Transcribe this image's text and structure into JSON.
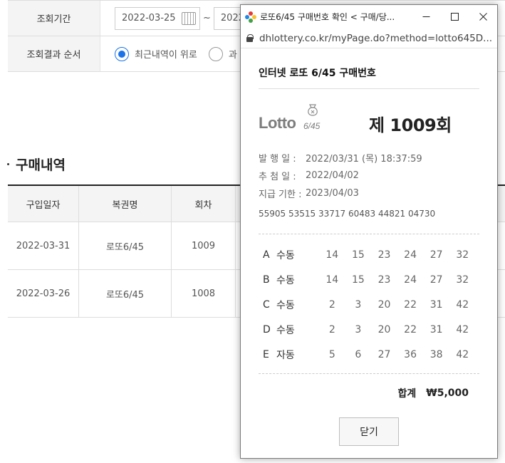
{
  "bg_page": {
    "filters": {
      "period_label": "조회기간",
      "date_start": "2022-03-25",
      "date_sep": "~",
      "date_end_partial": "2022",
      "order_label": "조회결과 순서",
      "order_option_1": "최근내역이 위로",
      "order_option_2": "과"
    },
    "section_title": "구매내역",
    "table": {
      "headers": [
        "구입일자",
        "복권명",
        "회차"
      ],
      "rows": [
        {
          "date": "2022-03-31",
          "name": "로또6/45",
          "round": "1009"
        },
        {
          "date": "2022-03-26",
          "name": "로또6/45",
          "round": "1008"
        }
      ]
    }
  },
  "popup": {
    "window_title": "로또6/45 구매번호 확인 < 구매/당...",
    "url": "dhlottery.co.kr/myPage.do?method=lotto645D...",
    "heading": "인터넷 로또 6/45 구매번호",
    "logo_word": "Lotto",
    "logo_sub": "6/45",
    "draw_title": "제 1009회",
    "info": {
      "issue_label": "발 행 일 :",
      "issue_value": "2022/03/31 (목) 18:37:59",
      "draw_label": "추 첨 일 :",
      "draw_value": "2022/04/02",
      "payout_label": "지급 기한 :",
      "payout_value": "2023/04/03",
      "serial": "55905 53515 33717 60483 44821 04730"
    },
    "games": [
      {
        "letter": "A",
        "mode": "수동",
        "numbers": [
          "14",
          "15",
          "23",
          "24",
          "27",
          "32"
        ]
      },
      {
        "letter": "B",
        "mode": "수동",
        "numbers": [
          "14",
          "15",
          "23",
          "24",
          "27",
          "32"
        ]
      },
      {
        "letter": "C",
        "mode": "수동",
        "numbers": [
          "2",
          "3",
          "20",
          "22",
          "31",
          "42"
        ]
      },
      {
        "letter": "D",
        "mode": "수동",
        "numbers": [
          "2",
          "3",
          "20",
          "22",
          "31",
          "42"
        ]
      },
      {
        "letter": "E",
        "mode": "자동",
        "numbers": [
          "5",
          "6",
          "27",
          "36",
          "38",
          "42"
        ]
      }
    ],
    "total_label": "합계",
    "total_value": "₩5,000",
    "close_label": "닫기"
  }
}
